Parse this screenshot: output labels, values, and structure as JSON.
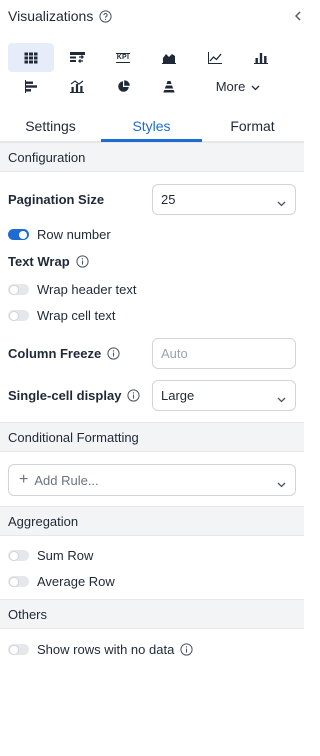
{
  "header": {
    "title": "Visualizations"
  },
  "viz_types": {
    "row1": [
      "table-icon",
      "pivot-table-icon",
      "kpi-icon",
      "area-chart-icon",
      "line-chart-icon",
      "bar-chart-icon"
    ],
    "row2": [
      "horizontal-bar-icon",
      "combo-chart-icon",
      "pie-chart-icon",
      "funnel-icon"
    ],
    "kpi_text": "KPI",
    "more_label": "More"
  },
  "tabs": {
    "settings": "Settings",
    "styles": "Styles",
    "format": "Format"
  },
  "sections": {
    "configuration": "Configuration",
    "conditional_formatting": "Conditional Formatting",
    "aggregation": "Aggregation",
    "others": "Others"
  },
  "config": {
    "pagination_label": "Pagination Size",
    "pagination_value": "25",
    "row_number_label": "Row number",
    "row_number_on": true,
    "text_wrap_label": "Text Wrap",
    "wrap_header_label": "Wrap header text",
    "wrap_cell_label": "Wrap cell text",
    "column_freeze_label": "Column Freeze",
    "column_freeze_placeholder": "Auto",
    "single_cell_label": "Single-cell display",
    "single_cell_value": "Large"
  },
  "conditional": {
    "add_rule_label": "Add Rule..."
  },
  "aggregation": {
    "sum_row_label": "Sum Row",
    "average_row_label": "Average Row"
  },
  "others": {
    "show_rows_label": "Show rows with no data"
  },
  "colors": {
    "accent": "#1f6bd4",
    "active_bg": "#e6edf8",
    "section_bg": "#f3f4f6"
  }
}
